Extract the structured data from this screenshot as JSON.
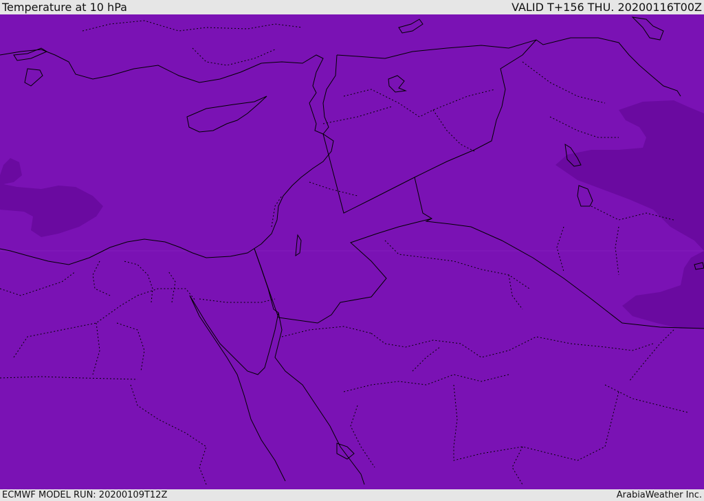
{
  "header": {
    "title": "Temperature at 10 hPa",
    "valid": "VALID T+156 THU. 20200116T00Z"
  },
  "footer": {
    "model_run": "ECMWF MODEL RUN: 20200109T12Z",
    "brand": "ArabiaWeather Inc."
  },
  "colors": {
    "field_main": "#7a12b4",
    "field_cold": "#6a0aa0",
    "frame": "#e6e6e6",
    "coastline": "#000000"
  }
}
